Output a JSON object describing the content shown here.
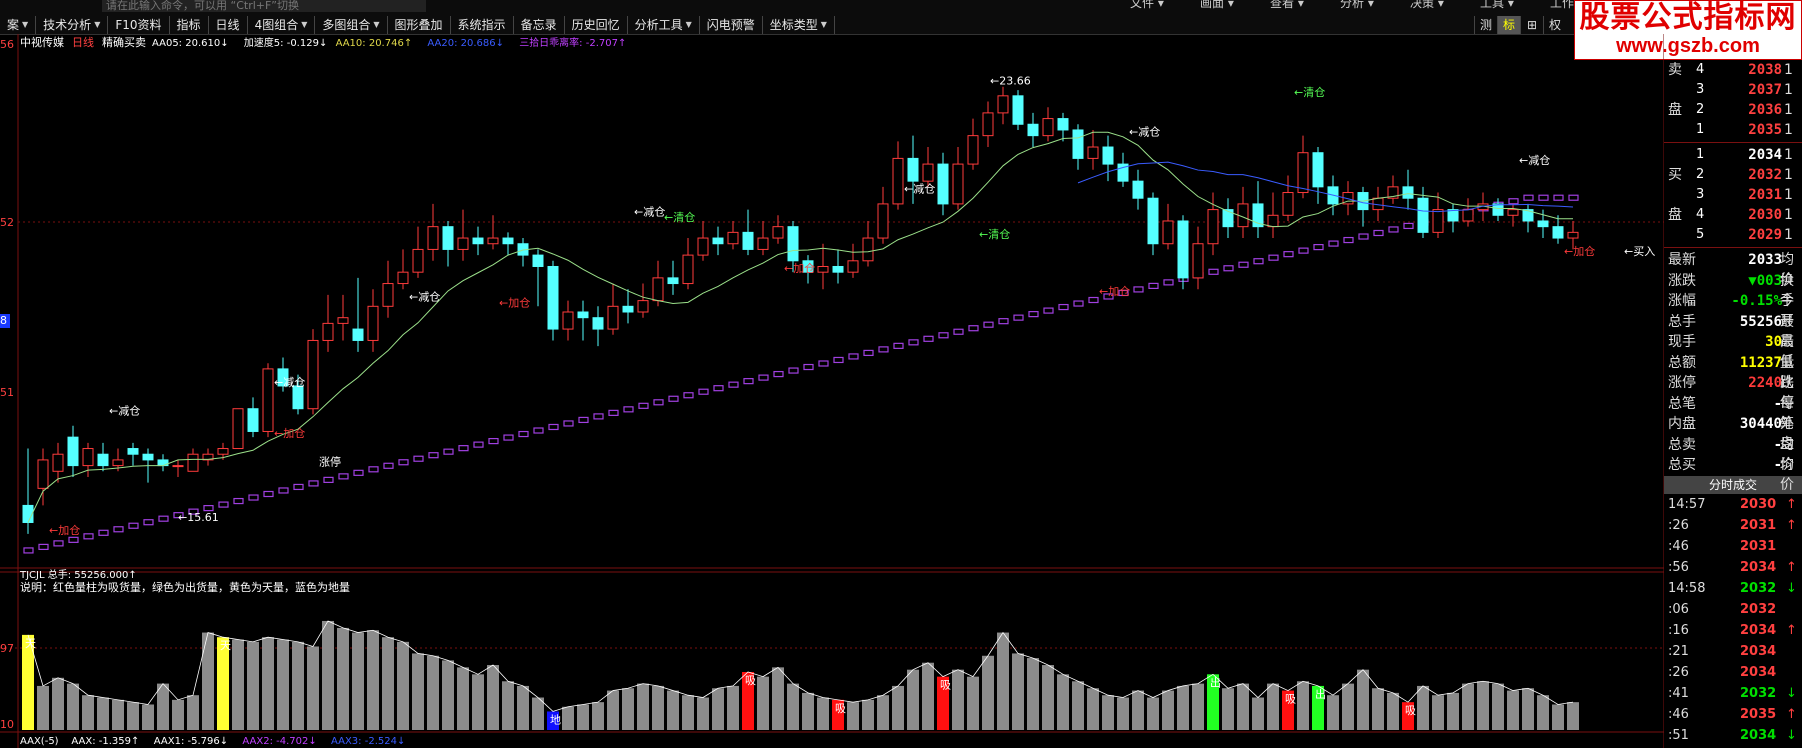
{
  "colors": {
    "up": "#ff3b3b",
    "down": "#55ffff",
    "ma5": "#ffffff",
    "ma10": "#e0d84a",
    "ma20": "#3a5cff",
    "trend": "#a040e0",
    "gridline": "#7a1010"
  },
  "menu_right": [
    "文件",
    "画面",
    "查看",
    "分析",
    "决策",
    "工具",
    "工作区"
  ],
  "search_placeholder": "请在此输入命令，可以用 “Ctrl+F”切换",
  "toolbar": [
    {
      "label": "案",
      "arrow": true
    },
    {
      "label": "技术分析",
      "arrow": true
    },
    {
      "label": "F10资料",
      "arrow": false
    },
    {
      "label": "指标",
      "arrow": false
    },
    {
      "label": "日线",
      "arrow": false
    },
    {
      "label": "4图组合",
      "arrow": true
    },
    {
      "label": "多图组合",
      "arrow": true
    },
    {
      "label": "图形叠加",
      "arrow": false
    },
    {
      "label": "系统指示",
      "arrow": false
    },
    {
      "label": "备忘录",
      "arrow": false
    },
    {
      "label": "历史回忆",
      "arrow": false
    },
    {
      "label": "分析工具",
      "arrow": true
    },
    {
      "label": "闪电预警",
      "arrow": false
    },
    {
      "label": "坐标类型",
      "arrow": true
    }
  ],
  "mode_tabs": [
    "测",
    "标",
    "⊞",
    "权"
  ],
  "logo": {
    "line1": "股票公式指标网",
    "line2": "www.gszb.com"
  },
  "main_header": {
    "stock": "中视传媒",
    "period": "日线",
    "indicator": "精确买卖",
    "items": [
      {
        "text": "AA05: 20.610↓",
        "color": "#ffffff"
      },
      {
        "text": "加速度5: -0.129↓",
        "color": "#ffffff"
      },
      {
        "text": "AA10: 20.746↑",
        "color": "#e0d84a"
      },
      {
        "text": "AA20: 20.686↓",
        "color": "#3a5cff"
      },
      {
        "text": "三拾日乖离率: -2.707↑",
        "color": "#c040ff"
      }
    ]
  },
  "axis_labels": {
    "main": [
      "56",
      "52",
      "8",
      "51"
    ],
    "sub": [
      "97",
      "10"
    ]
  },
  "price_labels": {
    "high": "23.66",
    "low": "15.61"
  },
  "signals": [
    {
      "text": "←加仓",
      "color": "#ff3b3b"
    },
    {
      "text": "←减仓",
      "color": "#ffffff"
    },
    {
      "text": "←清仓",
      "color": "#55ff55"
    },
    {
      "text": "涨停",
      "color": "#ffffff"
    },
    {
      "text": "←买入",
      "color": "#ffffff"
    }
  ],
  "sub_header": {
    "name": "TJCJL",
    "item": "总手: 55256.000↑"
  },
  "sub_desc": "说明：红色量柱为吸货量，绿色为出货量，黄色为天量，蓝色为地量",
  "vol_marks": {
    "tian": "天",
    "di": "地",
    "xi": "吸",
    "chu": "出"
  },
  "bottom_header": [
    {
      "text": "AAX(-5)",
      "color": "#ffffff"
    },
    {
      "text": "AAX: -1.359↑",
      "color": "#ffffff"
    },
    {
      "text": "AAX1: -5.796↓",
      "color": "#ffffff"
    },
    {
      "text": "AAX2: -4.702↓",
      "color": "#c040ff"
    },
    {
      "text": "AAX3: -2.524↓",
      "color": "#3a5cff"
    }
  ],
  "order_book": {
    "sell": [
      {
        "lvl": "4",
        "price": "2038"
      },
      {
        "lvl": "3",
        "price": "2037"
      },
      {
        "lvl": "2",
        "price": "2036"
      },
      {
        "lvl": "1",
        "price": "2035"
      }
    ],
    "sell_labels": [
      "卖",
      "盘"
    ],
    "buy": [
      {
        "lvl": "1",
        "price": "2034"
      },
      {
        "lvl": "2",
        "price": "2032"
      },
      {
        "lvl": "3",
        "price": "2031"
      },
      {
        "lvl": "4",
        "price": "2030"
      },
      {
        "lvl": "5",
        "price": "2029"
      }
    ],
    "buy_labels": [
      "买",
      "盘"
    ]
  },
  "stats": [
    {
      "label": "最新",
      "value": "2033",
      "color": "#ffffff",
      "extra": "均价"
    },
    {
      "label": "涨跌",
      "value": "▼003",
      "color": "#00e000",
      "extra": "换手"
    },
    {
      "label": "涨幅",
      "value": "-0.15%",
      "color": "#00e000",
      "extra": "今开"
    },
    {
      "label": "总手",
      "value": "55256",
      "color": "#ffffff",
      "extra": "最高"
    },
    {
      "label": "现手",
      "value": "30",
      "color": "#ffff00",
      "extra": "最低"
    },
    {
      "label": "总额",
      "value": "11237",
      "color": "#ffff00",
      "extra": "量比"
    },
    {
      "label": "涨停",
      "value": "2240",
      "color": "#ff3b3b",
      "extra": "跌停"
    },
    {
      "label": "总笔",
      "value": "-",
      "color": "#ffffff",
      "extra": "每笔"
    },
    {
      "label": "内盘",
      "value": "30440",
      "color": "#ffffff",
      "extra": "外盘"
    },
    {
      "label": "总卖",
      "value": "-",
      "color": "#ffffff",
      "extra": "均价"
    },
    {
      "label": "总买",
      "value": "-",
      "color": "#ffffff",
      "extra": "均价"
    }
  ],
  "ticks_title": "分时成交",
  "ticks": [
    {
      "time": "14:57",
      "price": "2030",
      "dir": "up"
    },
    {
      "time": ":26",
      "price": "2031",
      "dir": "up"
    },
    {
      "time": ":46",
      "price": "2031",
      "dir": ""
    },
    {
      "time": ":56",
      "price": "2034",
      "dir": "up"
    },
    {
      "time": "14:58",
      "price": "2032",
      "dir": "down"
    },
    {
      "time": ":06",
      "price": "2032",
      "dir": ""
    },
    {
      "time": ":16",
      "price": "2034",
      "dir": "up"
    },
    {
      "time": ":21",
      "price": "2034",
      "dir": ""
    },
    {
      "time": ":26",
      "price": "2034",
      "dir": ""
    },
    {
      "time": ":41",
      "price": "2032",
      "dir": "down"
    },
    {
      "time": ":46",
      "price": "2035",
      "dir": "up"
    },
    {
      "time": ":51",
      "price": "2034",
      "dir": "down"
    }
  ],
  "chart_data": {
    "type": "candlestick",
    "candles": [
      {
        "o": 16.3,
        "c": 16.0,
        "h": 17.3,
        "l": 15.8
      },
      {
        "o": 16.6,
        "c": 17.1,
        "h": 17.3,
        "l": 16.3
      },
      {
        "o": 16.9,
        "c": 17.2,
        "h": 17.4,
        "l": 16.7
      },
      {
        "o": 17.5,
        "c": 17.0,
        "h": 17.7,
        "l": 16.8
      },
      {
        "o": 17.0,
        "c": 17.3,
        "h": 17.4,
        "l": 16.8
      },
      {
        "o": 17.2,
        "c": 17.0,
        "h": 17.4,
        "l": 16.9
      },
      {
        "o": 17.0,
        "c": 17.1,
        "h": 17.3,
        "l": 16.9
      },
      {
        "o": 17.3,
        "c": 17.2,
        "h": 17.4,
        "l": 17.0
      },
      {
        "o": 17.2,
        "c": 17.1,
        "h": 17.3,
        "l": 16.7
      },
      {
        "o": 17.1,
        "c": 17.0,
        "h": 17.2,
        "l": 16.9
      },
      {
        "o": 17.0,
        "c": 17.0,
        "h": 17.1,
        "l": 16.8
      },
      {
        "o": 16.9,
        "c": 17.2,
        "h": 17.3,
        "l": 16.9
      },
      {
        "o": 17.1,
        "c": 17.2,
        "h": 17.3,
        "l": 17.0
      },
      {
        "o": 17.2,
        "c": 17.3,
        "h": 17.4,
        "l": 17.1
      },
      {
        "o": 17.3,
        "c": 18.0,
        "h": 18.0,
        "l": 17.3
      },
      {
        "o": 18.0,
        "c": 17.6,
        "h": 18.2,
        "l": 17.5
      },
      {
        "o": 17.6,
        "c": 18.7,
        "h": 18.8,
        "l": 17.5
      },
      {
        "o": 18.7,
        "c": 18.4,
        "h": 18.9,
        "l": 18.3
      },
      {
        "o": 18.4,
        "c": 18.0,
        "h": 18.6,
        "l": 17.9
      },
      {
        "o": 18.0,
        "c": 19.2,
        "h": 19.4,
        "l": 17.9
      },
      {
        "o": 19.2,
        "c": 19.5,
        "h": 20.0,
        "l": 19.0
      },
      {
        "o": 19.5,
        "c": 19.6,
        "h": 20.0,
        "l": 19.2
      },
      {
        "o": 19.4,
        "c": 19.2,
        "h": 20.3,
        "l": 19.0
      },
      {
        "o": 19.2,
        "c": 19.8,
        "h": 20.1,
        "l": 19.0
      },
      {
        "o": 19.8,
        "c": 20.2,
        "h": 20.6,
        "l": 19.6
      },
      {
        "o": 20.2,
        "c": 20.4,
        "h": 20.8,
        "l": 20.1
      },
      {
        "o": 20.4,
        "c": 20.8,
        "h": 21.2,
        "l": 20.3
      },
      {
        "o": 20.8,
        "c": 21.2,
        "h": 21.6,
        "l": 20.6
      },
      {
        "o": 21.2,
        "c": 20.8,
        "h": 21.3,
        "l": 20.5
      },
      {
        "o": 20.8,
        "c": 21.0,
        "h": 21.5,
        "l": 20.6
      },
      {
        "o": 21.0,
        "c": 20.9,
        "h": 21.2,
        "l": 20.7
      },
      {
        "o": 20.9,
        "c": 21.0,
        "h": 21.4,
        "l": 20.8
      },
      {
        "o": 21.0,
        "c": 20.9,
        "h": 21.1,
        "l": 20.7
      },
      {
        "o": 20.9,
        "c": 20.7,
        "h": 21.0,
        "l": 20.5
      },
      {
        "o": 20.7,
        "c": 20.5,
        "h": 20.8,
        "l": 19.8
      },
      {
        "o": 20.5,
        "c": 19.4,
        "h": 20.6,
        "l": 19.2
      },
      {
        "o": 19.4,
        "c": 19.7,
        "h": 19.9,
        "l": 19.2
      },
      {
        "o": 19.7,
        "c": 19.6,
        "h": 19.9,
        "l": 19.2
      },
      {
        "o": 19.6,
        "c": 19.4,
        "h": 19.8,
        "l": 19.1
      },
      {
        "o": 19.4,
        "c": 19.8,
        "h": 20.2,
        "l": 19.3
      },
      {
        "o": 19.8,
        "c": 19.7,
        "h": 20.1,
        "l": 19.5
      },
      {
        "o": 19.7,
        "c": 19.9,
        "h": 20.2,
        "l": 19.6
      },
      {
        "o": 19.9,
        "c": 20.3,
        "h": 20.6,
        "l": 19.8
      },
      {
        "o": 20.3,
        "c": 20.2,
        "h": 20.6,
        "l": 20.0
      },
      {
        "o": 20.2,
        "c": 20.7,
        "h": 21.0,
        "l": 20.1
      },
      {
        "o": 20.7,
        "c": 21.0,
        "h": 21.3,
        "l": 20.6
      },
      {
        "o": 21.0,
        "c": 20.9,
        "h": 21.2,
        "l": 20.7
      },
      {
        "o": 20.9,
        "c": 21.1,
        "h": 21.3,
        "l": 20.8
      },
      {
        "o": 21.1,
        "c": 20.8,
        "h": 21.5,
        "l": 20.7
      },
      {
        "o": 20.8,
        "c": 21.0,
        "h": 21.3,
        "l": 20.7
      },
      {
        "o": 21.0,
        "c": 21.2,
        "h": 21.4,
        "l": 20.9
      },
      {
        "o": 21.2,
        "c": 20.6,
        "h": 21.3,
        "l": 20.4
      },
      {
        "o": 20.6,
        "c": 20.4,
        "h": 20.7,
        "l": 20.2
      },
      {
        "o": 20.4,
        "c": 20.5,
        "h": 20.9,
        "l": 20.1
      },
      {
        "o": 20.5,
        "c": 20.4,
        "h": 20.8,
        "l": 20.2
      },
      {
        "o": 20.4,
        "c": 20.6,
        "h": 20.9,
        "l": 20.3
      },
      {
        "o": 20.6,
        "c": 21.0,
        "h": 21.3,
        "l": 20.5
      },
      {
        "o": 21.0,
        "c": 21.6,
        "h": 21.9,
        "l": 20.9
      },
      {
        "o": 21.6,
        "c": 22.4,
        "h": 22.7,
        "l": 21.5
      },
      {
        "o": 22.4,
        "c": 22.0,
        "h": 22.8,
        "l": 21.6
      },
      {
        "o": 22.0,
        "c": 22.3,
        "h": 22.6,
        "l": 21.9
      },
      {
        "o": 22.3,
        "c": 21.6,
        "h": 22.5,
        "l": 21.4
      },
      {
        "o": 21.6,
        "c": 22.3,
        "h": 22.6,
        "l": 21.5
      },
      {
        "o": 22.3,
        "c": 22.8,
        "h": 23.1,
        "l": 22.2
      },
      {
        "o": 22.8,
        "c": 23.2,
        "h": 23.4,
        "l": 22.6
      },
      {
        "o": 23.2,
        "c": 23.5,
        "h": 23.66,
        "l": 23.0
      },
      {
        "o": 23.5,
        "c": 23.0,
        "h": 23.6,
        "l": 22.9
      },
      {
        "o": 23.0,
        "c": 22.8,
        "h": 23.2,
        "l": 22.6
      },
      {
        "o": 22.8,
        "c": 23.1,
        "h": 23.3,
        "l": 22.7
      },
      {
        "o": 23.1,
        "c": 22.9,
        "h": 23.2,
        "l": 22.7
      },
      {
        "o": 22.9,
        "c": 22.4,
        "h": 23.0,
        "l": 22.2
      },
      {
        "o": 22.4,
        "c": 22.6,
        "h": 22.9,
        "l": 22.2
      },
      {
        "o": 22.6,
        "c": 22.3,
        "h": 22.8,
        "l": 22.0
      },
      {
        "o": 22.3,
        "c": 22.0,
        "h": 22.5,
        "l": 21.9
      },
      {
        "o": 22.0,
        "c": 21.7,
        "h": 22.2,
        "l": 21.5
      },
      {
        "o": 21.7,
        "c": 20.9,
        "h": 21.8,
        "l": 20.7
      },
      {
        "o": 20.9,
        "c": 21.3,
        "h": 21.6,
        "l": 20.8
      },
      {
        "o": 21.3,
        "c": 20.3,
        "h": 21.4,
        "l": 20.1
      },
      {
        "o": 20.3,
        "c": 20.9,
        "h": 21.2,
        "l": 20.1
      },
      {
        "o": 20.9,
        "c": 21.5,
        "h": 21.8,
        "l": 20.7
      },
      {
        "o": 21.5,
        "c": 21.2,
        "h": 21.7,
        "l": 21.0
      },
      {
        "o": 21.2,
        "c": 21.6,
        "h": 21.9,
        "l": 21.0
      },
      {
        "o": 21.6,
        "c": 21.2,
        "h": 22.0,
        "l": 21.0
      },
      {
        "o": 21.2,
        "c": 21.4,
        "h": 21.8,
        "l": 21.0
      },
      {
        "o": 21.4,
        "c": 21.8,
        "h": 22.1,
        "l": 21.3
      },
      {
        "o": 21.8,
        "c": 22.5,
        "h": 22.8,
        "l": 21.7
      },
      {
        "o": 22.5,
        "c": 21.9,
        "h": 22.6,
        "l": 21.6
      },
      {
        "o": 21.9,
        "c": 21.6,
        "h": 22.1,
        "l": 21.4
      },
      {
        "o": 21.6,
        "c": 21.8,
        "h": 22.0,
        "l": 21.4
      },
      {
        "o": 21.8,
        "c": 21.5,
        "h": 21.9,
        "l": 21.2
      },
      {
        "o": 21.5,
        "c": 21.7,
        "h": 21.9,
        "l": 21.3
      },
      {
        "o": 21.7,
        "c": 21.9,
        "h": 22.1,
        "l": 21.6
      },
      {
        "o": 21.9,
        "c": 21.7,
        "h": 22.2,
        "l": 21.5
      },
      {
        "o": 21.7,
        "c": 21.1,
        "h": 21.9,
        "l": 21.0
      },
      {
        "o": 21.1,
        "c": 21.5,
        "h": 21.8,
        "l": 21.0
      },
      {
        "o": 21.5,
        "c": 21.3,
        "h": 21.6,
        "l": 21.1
      },
      {
        "o": 21.3,
        "c": 21.5,
        "h": 21.7,
        "l": 21.2
      },
      {
        "o": 21.5,
        "c": 21.6,
        "h": 21.8,
        "l": 21.3
      },
      {
        "o": 21.6,
        "c": 21.4,
        "h": 21.7,
        "l": 21.3
      },
      {
        "o": 21.4,
        "c": 21.5,
        "h": 21.6,
        "l": 21.2
      },
      {
        "o": 21.5,
        "c": 21.3,
        "h": 21.6,
        "l": 21.1
      },
      {
        "o": 21.3,
        "c": 21.2,
        "h": 21.5,
        "l": 21.0
      },
      {
        "o": 21.2,
        "c": 21.0,
        "h": 21.4,
        "l": 20.9
      },
      {
        "o": 21.0,
        "c": 21.1,
        "h": 21.3,
        "l": 20.8
      }
    ],
    "volumes": [
      82,
      38,
      45,
      40,
      30,
      28,
      26,
      24,
      22,
      40,
      26,
      30,
      84,
      80,
      78,
      76,
      80,
      78,
      76,
      72,
      94,
      88,
      84,
      86,
      80,
      76,
      66,
      64,
      60,
      54,
      48,
      56,
      42,
      38,
      28,
      16,
      20,
      22,
      24,
      34,
      36,
      40,
      38,
      34,
      30,
      28,
      36,
      38,
      50,
      46,
      54,
      40,
      32,
      28,
      26,
      24,
      26,
      30,
      38,
      52,
      58,
      46,
      52,
      46,
      64,
      84,
      66,
      62,
      56,
      48,
      42,
      36,
      30,
      28,
      34,
      28,
      34,
      38,
      40,
      48,
      36,
      40,
      28,
      40,
      34,
      42,
      38,
      30,
      40,
      52,
      36,
      32,
      24,
      38,
      30,
      32,
      40,
      42,
      40,
      34,
      36,
      30,
      22,
      24
    ],
    "vol_colors": {
      "0": "yellow",
      "13": "yellow",
      "35": "blue",
      "48": "red",
      "54": "red",
      "61": "red",
      "79": "green",
      "84": "red",
      "86": "green",
      "92": "red"
    },
    "ma_note": "AA05 / AA10 / AA20 moving averages",
    "price_range": [
      15.2,
      24.2
    ],
    "volume_range": [
      0,
      100
    ]
  }
}
